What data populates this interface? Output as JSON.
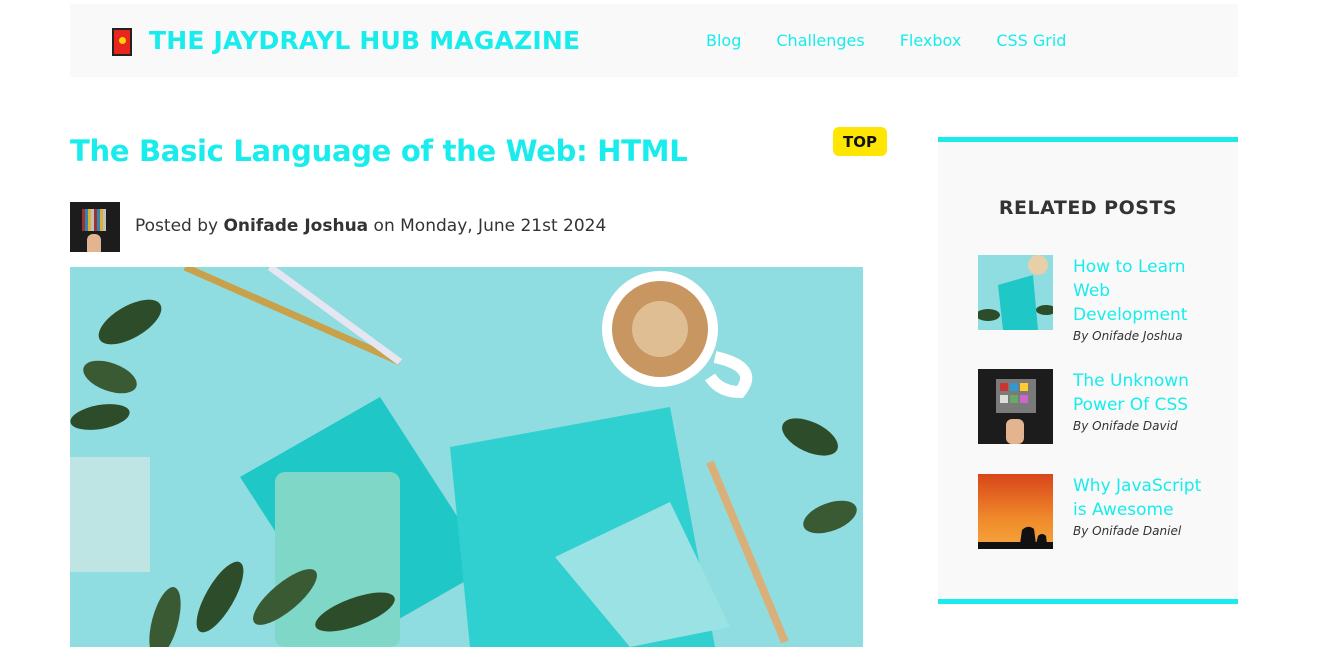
{
  "header": {
    "site_title": "THE JAYDRAYL HUB MAGAZINE",
    "nav": [
      "Blog",
      "Challenges",
      "Flexbox",
      "CSS Grid"
    ]
  },
  "post": {
    "title": "The Basic Language of the Web: HTML",
    "badge": "TOP",
    "meta_prefix": "Posted by ",
    "author": "Onifade Joshua",
    "meta_suffix": " on Monday, June 21st 2024"
  },
  "sidebar": {
    "title": "RELATED POSTS",
    "items": [
      {
        "title": "How to Learn Web Development",
        "author": "By Onifade Joshua"
      },
      {
        "title": "The Unknown Power Of CSS",
        "author": "By Onifade David"
      },
      {
        "title": "Why JavaScript is Awesome",
        "author": "By Onifade Daniel"
      }
    ]
  },
  "colors": {
    "accent": "#18ecec",
    "badge": "#ffe600",
    "panel": "#f9f9f9"
  }
}
